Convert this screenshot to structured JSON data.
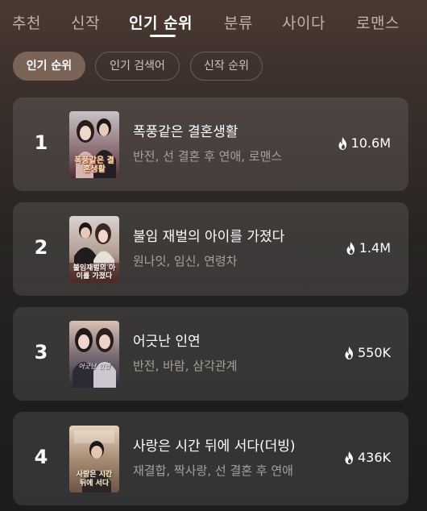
{
  "tabs": [
    {
      "label": "추천"
    },
    {
      "label": "신작"
    },
    {
      "label": "인기 순위",
      "active": true
    },
    {
      "label": "분류"
    },
    {
      "label": "사이다"
    },
    {
      "label": "로맨스"
    }
  ],
  "chips": [
    {
      "label": "인기 순위",
      "active": true
    },
    {
      "label": "인기 검색어"
    },
    {
      "label": "신작 순위"
    }
  ],
  "rankings": [
    {
      "rank": "1",
      "title": "폭풍같은 결혼생활",
      "tags": "반전, 선 결혼 후 연애, 로맨스",
      "views": "10.6M",
      "cover_text": "폭풍같은 결혼생활"
    },
    {
      "rank": "2",
      "title": "불임 재벌의 아이를 가졌다",
      "tags": "원나잇, 임신, 연령차",
      "views": "1.4M",
      "cover_text": "불임재벌의 아이를 가졌다"
    },
    {
      "rank": "3",
      "title": "어긋난 인연",
      "tags": "반전, 바람, 삼각관계",
      "views": "550K",
      "cover_text": "어긋난 인연"
    },
    {
      "rank": "4",
      "title": "사랑은 시간 뒤에 서다(더빙)",
      "tags": "재결합, 짝사랑, 선 결혼 후 연애",
      "views": "436K",
      "cover_text": "사랑은 시간 뒤에 서다"
    }
  ],
  "icons": {
    "views": "fire-icon"
  }
}
